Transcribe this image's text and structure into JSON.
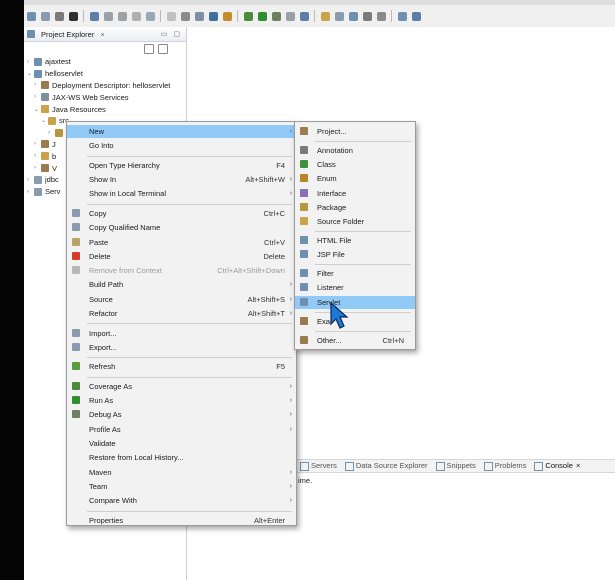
{
  "panel": {
    "title": "Project Explorer",
    "close_glyph": "×",
    "tree": [
      {
        "label": "ajaxtest",
        "expander": "›",
        "indent": 0
      },
      {
        "label": "helloservlet",
        "expander": "⌄",
        "indent": 0
      },
      {
        "label": "Deployment Descriptor: helloservlet",
        "expander": "›",
        "indent": 1
      },
      {
        "label": "JAX-WS Web Services",
        "expander": "›",
        "indent": 1
      },
      {
        "label": "Java Resources",
        "expander": "⌄",
        "indent": 1
      },
      {
        "label": "src",
        "expander": "⌄",
        "indent": 2
      },
      {
        "label": "",
        "expander": "›",
        "indent": 3
      },
      {
        "label": "J",
        "expander": "›",
        "indent": 1
      },
      {
        "label": "b",
        "expander": "›",
        "indent": 1
      },
      {
        "label": "V",
        "expander": "›",
        "indent": 1
      },
      {
        "label": "jdbc",
        "expander": "›",
        "indent": 0
      },
      {
        "label": "Serv",
        "expander": "›",
        "indent": 0
      }
    ]
  },
  "context_menu": [
    {
      "label": "New",
      "arrow": "›",
      "selected": true,
      "icon": ""
    },
    {
      "label": "Go Into"
    },
    {
      "sep": true
    },
    {
      "label": "Open Type Hierarchy",
      "shortcut": "F4"
    },
    {
      "label": "Show In",
      "shortcut": "Alt+Shift+W",
      "arrow": "›"
    },
    {
      "label": "Show in Local Terminal",
      "arrow": "›"
    },
    {
      "sep": true
    },
    {
      "label": "Copy",
      "shortcut": "Ctrl+C",
      "icon": "copy-icon",
      "color": "#8a9bb0"
    },
    {
      "label": "Copy Qualified Name",
      "icon": "copy-qualified-icon",
      "color": "#8a9bb0"
    },
    {
      "label": "Paste",
      "shortcut": "Ctrl+V",
      "icon": "paste-icon",
      "color": "#b9a36b"
    },
    {
      "label": "Delete",
      "shortcut": "Delete",
      "icon": "delete-icon",
      "color": "#d63a2a"
    },
    {
      "label": "Remove from Context",
      "shortcut": "Ctrl+Alt+Shift+Down",
      "disabled": true,
      "icon": "remove-context-icon",
      "color": "#b8b8b8"
    },
    {
      "label": "Build Path",
      "arrow": "›"
    },
    {
      "label": "Source",
      "shortcut": "Alt+Shift+S",
      "arrow": "›"
    },
    {
      "label": "Refactor",
      "shortcut": "Alt+Shift+T",
      "arrow": "›"
    },
    {
      "sep": true
    },
    {
      "label": "Import...",
      "icon": "import-icon",
      "color": "#8a9bb0"
    },
    {
      "label": "Export...",
      "icon": "export-icon",
      "color": "#8a9bb0"
    },
    {
      "sep": true
    },
    {
      "label": "Refresh",
      "shortcut": "F5",
      "icon": "refresh-icon",
      "color": "#5c9a3e"
    },
    {
      "sep": true
    },
    {
      "label": "Coverage As",
      "arrow": "›",
      "icon": "coverage-icon",
      "color": "#4b8b3b"
    },
    {
      "label": "Run As",
      "arrow": "›",
      "icon": "run-icon",
      "color": "#2f8f2f"
    },
    {
      "label": "Debug As",
      "arrow": "›",
      "icon": "debug-icon",
      "color": "#6f7f5f"
    },
    {
      "label": "Profile As",
      "arrow": "›"
    },
    {
      "label": "Validate"
    },
    {
      "label": "Restore from Local History..."
    },
    {
      "label": "Maven",
      "arrow": "›"
    },
    {
      "label": "Team",
      "arrow": "›"
    },
    {
      "label": "Compare With",
      "arrow": "›"
    },
    {
      "sep": true
    },
    {
      "label": "Properties",
      "shortcut": "Alt+Enter"
    }
  ],
  "submenu": [
    {
      "label": "Project...",
      "icon": "project-icon",
      "color": "#9a7b4f"
    },
    {
      "sep": true
    },
    {
      "label": "Annotation",
      "icon": "annotation-icon",
      "color": "#7a7a7a"
    },
    {
      "label": "Class",
      "icon": "class-icon",
      "color": "#3f8f3f"
    },
    {
      "label": "Enum",
      "icon": "enum-icon",
      "color": "#b8852e"
    },
    {
      "label": "Interface",
      "icon": "interface-icon",
      "color": "#8a6fb8"
    },
    {
      "label": "Package",
      "icon": "package-icon",
      "color": "#b8963c"
    },
    {
      "label": "Source Folder",
      "icon": "source-folder-icon",
      "color": "#c9a24a"
    },
    {
      "sep": true
    },
    {
      "label": "HTML File",
      "icon": "html-file-icon",
      "color": "#6f8fb0"
    },
    {
      "label": "JSP File",
      "icon": "jsp-file-icon",
      "color": "#6f8fb0"
    },
    {
      "sep": true
    },
    {
      "label": "Filter",
      "icon": "filter-icon",
      "color": "#6f8fb0"
    },
    {
      "label": "Listener",
      "icon": "listener-icon",
      "color": "#6f8fb0"
    },
    {
      "label": "Servlet",
      "icon": "servlet-icon",
      "color": "#6f8fb0",
      "selected": true
    },
    {
      "sep": true
    },
    {
      "label": "Exar",
      "icon": "example-icon",
      "color": "#9a7b4f"
    },
    {
      "sep": true
    },
    {
      "label": "Other...",
      "shortcut": "Ctrl+N",
      "icon": "other-icon",
      "color": "#9a7b4f"
    }
  ],
  "bottom_tabs": [
    {
      "label": "Servers",
      "active": false
    },
    {
      "label": "Data Source Explorer",
      "active": false
    },
    {
      "label": "Snippets",
      "active": false
    },
    {
      "label": "Problems",
      "active": false
    },
    {
      "label": "Console",
      "active": true,
      "suffix": "×"
    }
  ],
  "console_text": "ime.",
  "colors": {
    "selection": "#91c9f7",
    "menu_bg": "#f2f2f2",
    "cursor_fill": "#1e78d6"
  }
}
